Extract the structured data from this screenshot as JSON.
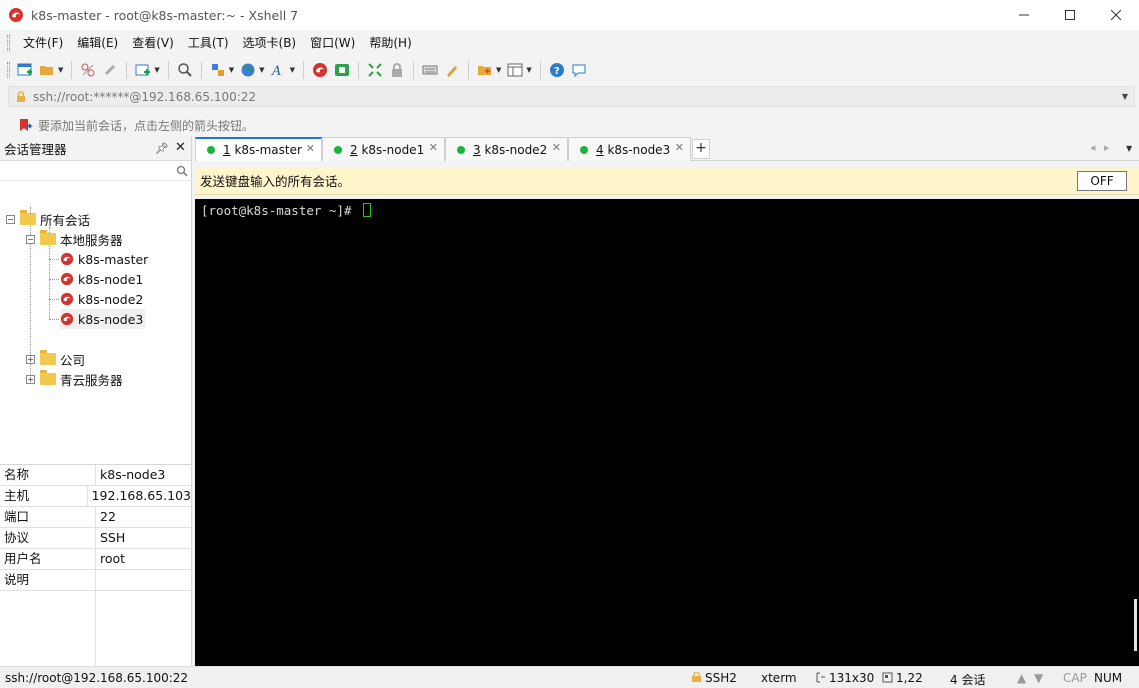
{
  "window": {
    "title": "k8s-master - root@k8s-master:~ - Xshell 7"
  },
  "menu": [
    "文件(F)",
    "编辑(E)",
    "查看(V)",
    "工具(T)",
    "选项卡(B)",
    "窗口(W)",
    "帮助(H)"
  ],
  "toolbar": {
    "icons": [
      "new-session-icon",
      "open-folder-icon",
      "disconnect-icon",
      "reconnect-icon",
      "new-tab-icon",
      "find-icon",
      "transfer-icon",
      "globe-icon",
      "font-icon",
      "xshell-icon",
      "xftp-icon",
      "fullscreen-icon",
      "lock-icon",
      "keyboard-icon",
      "highlight-icon",
      "add-session-icon",
      "layout-icon",
      "help-icon",
      "chat-icon"
    ]
  },
  "address": {
    "value": "ssh://root:******@192.168.65.100:22"
  },
  "hint": {
    "text": "要添加当前会话，点击左侧的箭头按钮。"
  },
  "session_manager": {
    "title": "会话管理器",
    "tree": {
      "root": "所有会话",
      "local": "本地服务器",
      "hosts": [
        "k8s-master",
        "k8s-node1",
        "k8s-node2",
        "k8s-node3"
      ],
      "company": "公司",
      "qingyun": "青云服务器"
    },
    "props": [
      {
        "key": "名称",
        "value": "k8s-node3"
      },
      {
        "key": "主机",
        "value": "192.168.65.103"
      },
      {
        "key": "端口",
        "value": "22"
      },
      {
        "key": "协议",
        "value": "SSH"
      },
      {
        "key": "用户名",
        "value": "root"
      },
      {
        "key": "说明",
        "value": ""
      }
    ]
  },
  "tabs": [
    {
      "num": "1",
      "label": " k8s-master"
    },
    {
      "num": "2",
      "label": " k8s-node1"
    },
    {
      "num": "3",
      "label": " k8s-node2"
    },
    {
      "num": "4",
      "label": " k8s-node3"
    }
  ],
  "broadcast": {
    "text": "发送键盘输入的所有会话。",
    "button": "OFF"
  },
  "terminal": {
    "prompt": "[root@k8s-master ~]# "
  },
  "status": {
    "connection": "ssh://root@192.168.65.100:22",
    "protocol": "SSH2",
    "term": "xterm",
    "size": "131x30",
    "position": "1,22",
    "sessions": "4 会话",
    "cap": "CAP",
    "num": "NUM"
  },
  "colors": {
    "tab_accent": "#1a73e8",
    "status_dot": "#19b53a",
    "broadcast_bg": "#fff5cc",
    "terminal_bg": "#000000"
  }
}
